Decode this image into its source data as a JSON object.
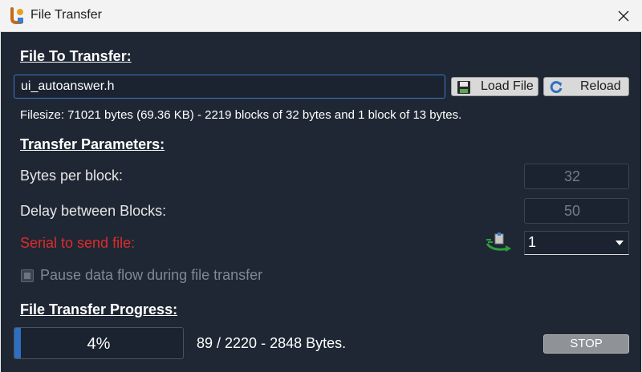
{
  "window": {
    "title": "File Transfer",
    "app_icon": "file-transfer-app-icon",
    "close_icon": "close-icon"
  },
  "file_section": {
    "title": "File To Transfer:",
    "file_value": "ui_autoanswer.h",
    "load_button": "Load File",
    "load_icon": "floppy-disk-icon",
    "reload_button": "Reload",
    "reload_icon": "refresh-icon",
    "filesize_text": "Filesize: 71021 bytes (69.36 KB) - 2219 blocks of 32 bytes and 1 block of 13 bytes."
  },
  "params": {
    "title": "Transfer Parameters:",
    "bytes_per_block_label": "Bytes per block:",
    "bytes_per_block_value": "32",
    "delay_label": "Delay between Blocks:",
    "delay_value": "50",
    "serial_label": "Serial to send file:",
    "serial_value": "1",
    "serial_icon": "serial-send-icon",
    "pause_label": "Pause data flow during file transfer",
    "pause_checked": true
  },
  "progress": {
    "title": "File Transfer Progress:",
    "percent": "4%",
    "fraction": 0.04,
    "status_text": "89 / 2220 - 2848 Bytes.",
    "stop_button": "STOP"
  },
  "colors": {
    "background": "#1e2733",
    "accent": "#3d78c7",
    "progress_fill": "#2f6fc1",
    "warning_label": "#e02b2b"
  }
}
